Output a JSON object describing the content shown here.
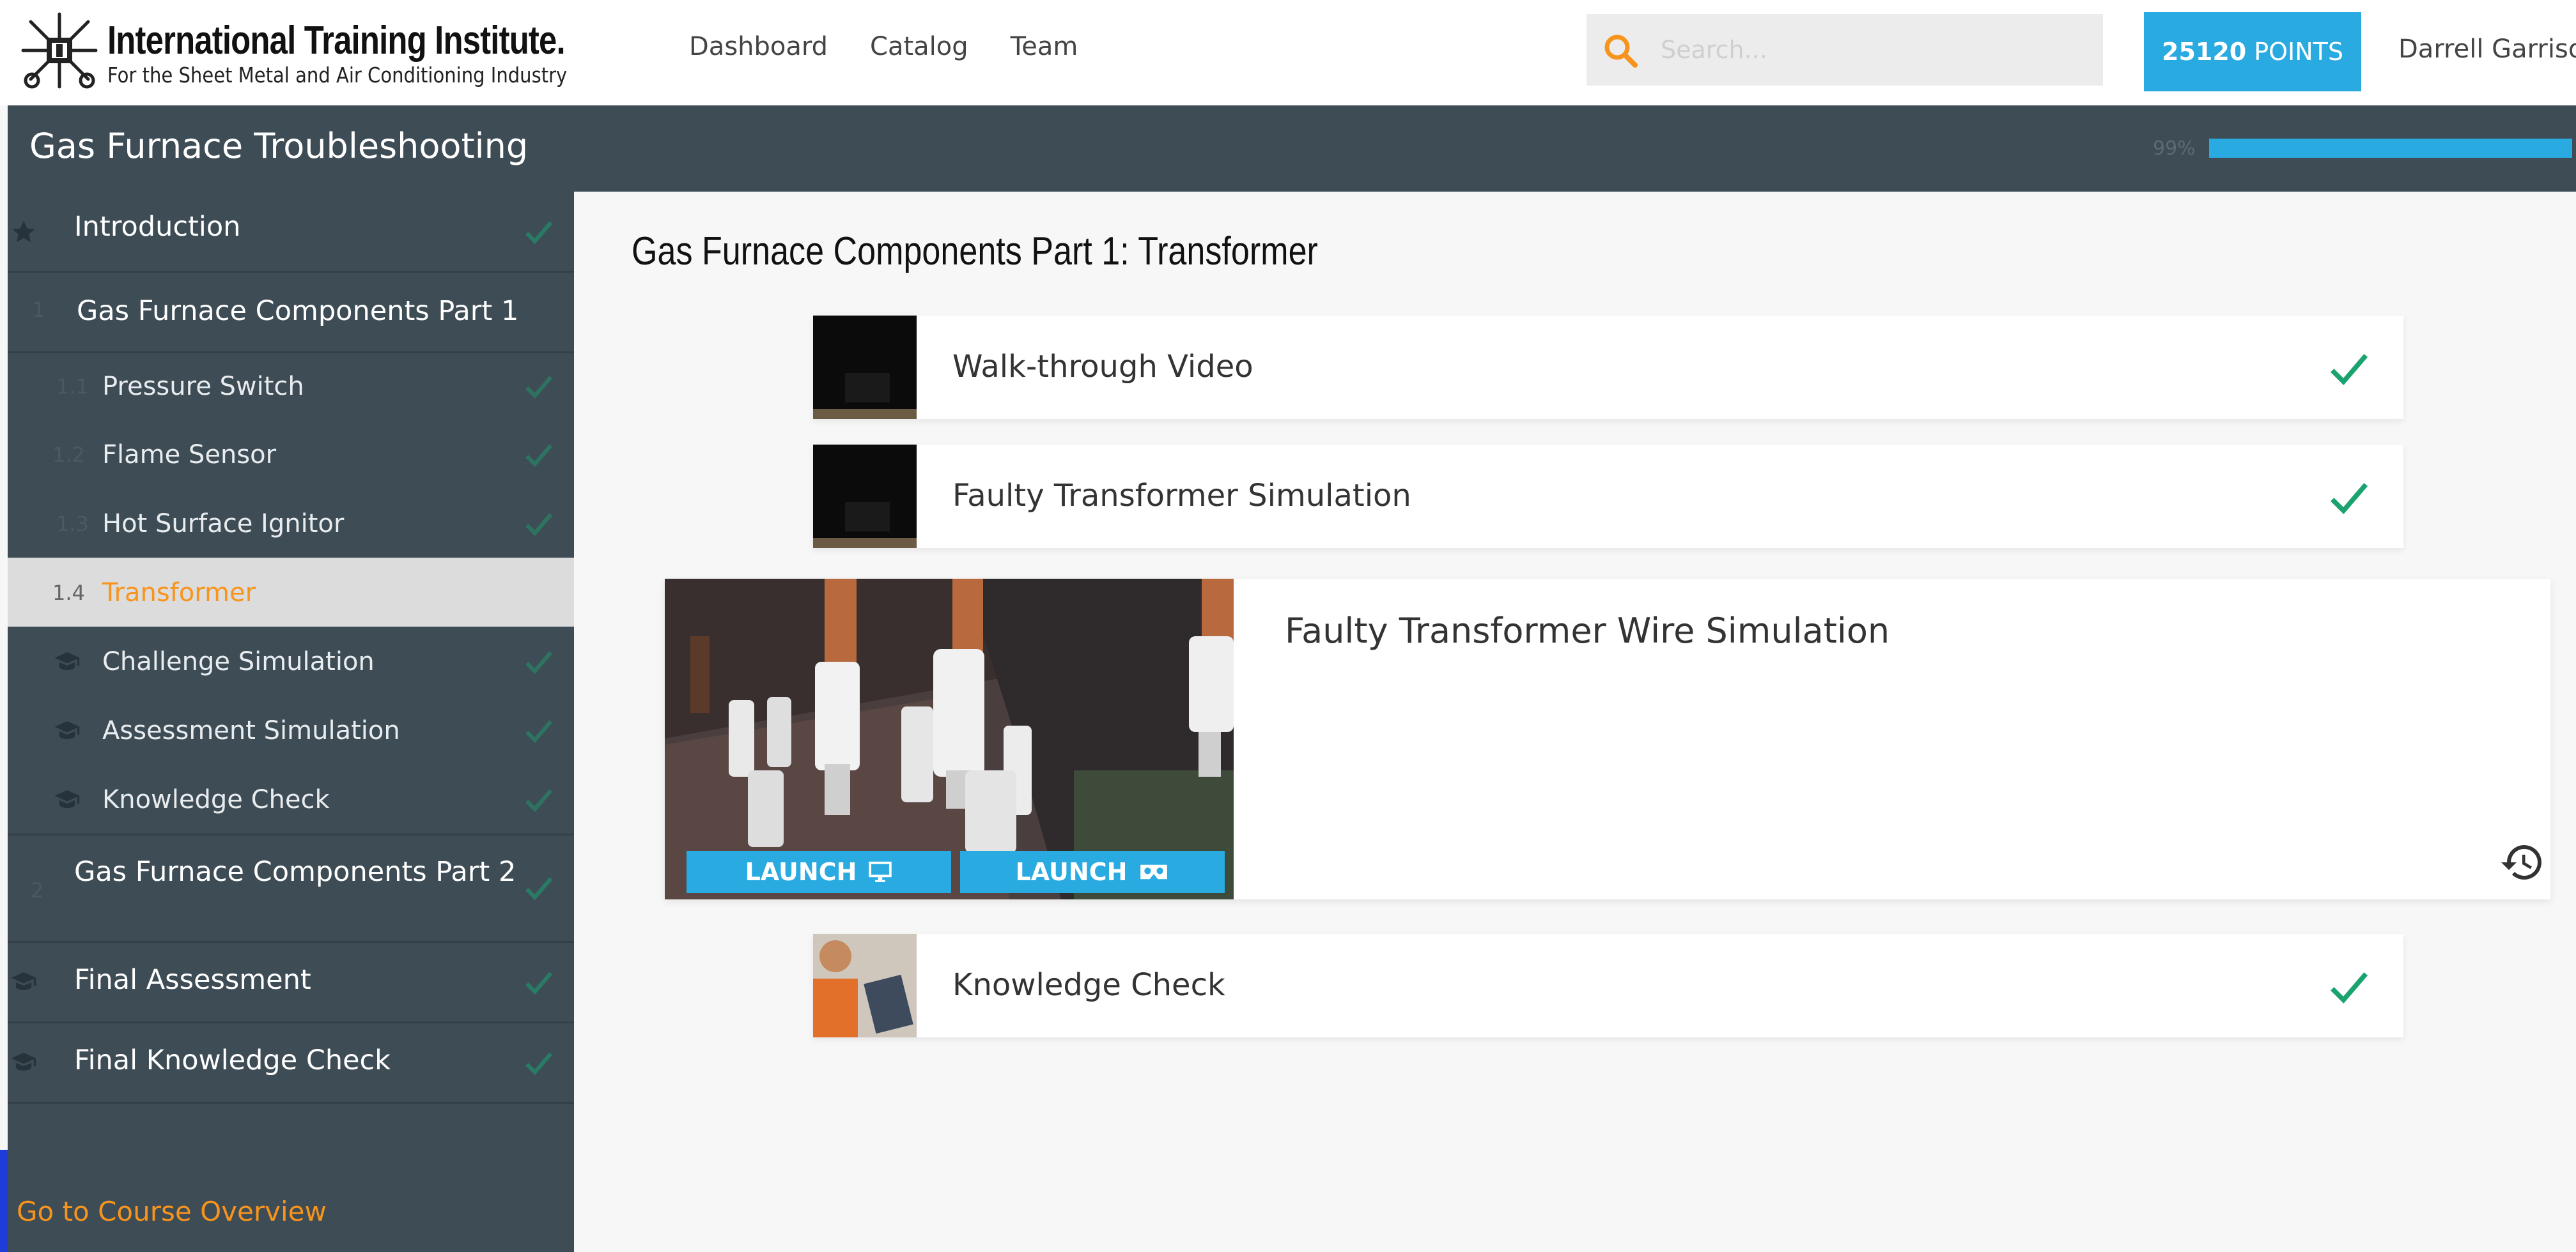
{
  "header": {
    "logo": {
      "title": "International Training Institute.",
      "subtitle": "For the Sheet Metal and Air Conditioning Industry"
    },
    "nav": [
      "Dashboard",
      "Catalog",
      "Team"
    ],
    "search": {
      "placeholder": "Search...",
      "icon": "search-icon"
    },
    "points": {
      "value": "25120",
      "label": "POINTS"
    },
    "user_name": "Darrell Garrison"
  },
  "course": {
    "title": "Gas Furnace Troubleshooting",
    "progress_label": "99%",
    "progress_fraction": 0.99
  },
  "sidebar": {
    "modules": [
      {
        "label": "Introduction",
        "icon": "star-icon",
        "completed": true
      },
      {
        "label": "Gas Furnace Components Part 1",
        "number": "1",
        "lessons": [
          {
            "number": "1.1",
            "label": "Pressure Switch",
            "completed": true
          },
          {
            "number": "1.2",
            "label": "Flame Sensor",
            "completed": true
          },
          {
            "number": "1.3",
            "label": "Hot Surface Ignitor",
            "completed": true
          },
          {
            "number": "1.4",
            "label": "Transformer",
            "active": true
          },
          {
            "label": "Challenge Simulation",
            "icon": "graduation-cap-icon",
            "completed": true
          },
          {
            "label": "Assessment Simulation",
            "icon": "graduation-cap-icon",
            "completed": true
          },
          {
            "label": "Knowledge Check",
            "icon": "graduation-cap-icon",
            "completed": true
          }
        ]
      },
      {
        "label": "Gas Furnace Components Part 2",
        "number": "2",
        "completed": true
      },
      {
        "label": "Final Assessment",
        "icon": "graduation-cap-icon",
        "completed": true
      },
      {
        "label": "Final Knowledge Check",
        "icon": "graduation-cap-icon",
        "completed": true
      }
    ],
    "footer_link": "Go to Course Overview"
  },
  "main": {
    "section_title": "Gas Furnace Components Part 1: Transformer",
    "activities": [
      {
        "title": "Walk-through Video",
        "completed": true
      },
      {
        "title": "Faulty Transformer Simulation",
        "completed": true
      },
      {
        "title": "Faulty Transformer Wire Simulation",
        "launch_desktop": "LAUNCH",
        "launch_vr": "LAUNCH",
        "icon_desktop": "monitor-icon",
        "icon_vr": "vr-headset-icon",
        "icon_history": "history-icon"
      },
      {
        "title": "Knowledge Check",
        "completed": true
      }
    ]
  },
  "colors": {
    "accent": "#29aae1",
    "sidebar": "#3e4c55",
    "orange": "#f7941d",
    "check": "#1aa36f"
  }
}
